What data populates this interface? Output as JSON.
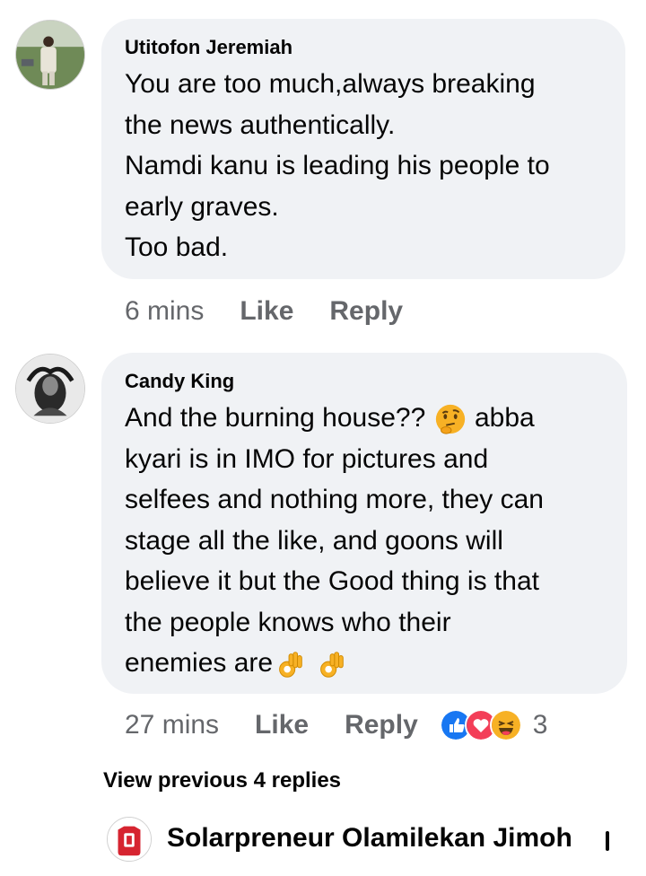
{
  "comments": [
    {
      "author": "Utitofon Jeremiah",
      "text": "You are too much,always breaking\nthe news authentically.\nNamdi kanu is leading his people to\nearly graves.\nToo bad.",
      "time": "6 mins",
      "like_label": "Like",
      "reply_label": "Reply"
    },
    {
      "author": "Candy King",
      "text_a": "And the burning house?? ",
      "emoji_think": "thinking-face-emoji",
      "text_b": " abba\nkyari is in IMO for pictures and\nselfees and nothing more,  they can\nstage all the like, and goons will\nbelieve it but the Good thing is that\nthe people knows who their\nenemies are",
      "emoji_ok": "ok-hand-emoji",
      "time": "27 mins",
      "like_label": "Like",
      "reply_label": "Reply",
      "reaction_icons": [
        "like-reaction-icon",
        "love-reaction-icon",
        "haha-reaction-icon"
      ],
      "reaction_count": "3"
    }
  ],
  "view_previous": "View previous 4 replies",
  "next_comment_author": "Solarpreneur Olamilekan Jimoh",
  "colors": {
    "bubble": "#f0f2f5",
    "meta_text": "#65676b",
    "like_blue": "#1877f2",
    "love_red": "#f33e58",
    "haha_yellow": "#f7b125"
  }
}
